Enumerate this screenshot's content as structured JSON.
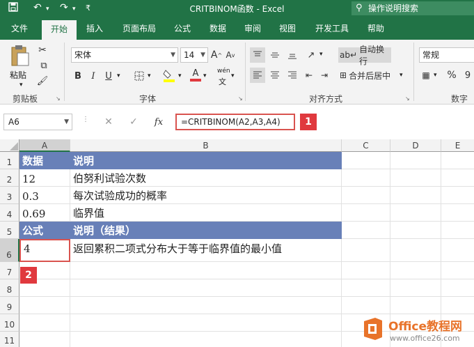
{
  "window": {
    "title": "CRITBINOM函数  -  Excel",
    "tell_me": "操作说明搜索"
  },
  "tabs": [
    "文件",
    "开始",
    "插入",
    "页面布局",
    "公式",
    "数据",
    "审阅",
    "视图",
    "开发工具",
    "帮助"
  ],
  "ribbon": {
    "clipboard": {
      "paste": "粘贴",
      "group": "剪贴板"
    },
    "font": {
      "name": "宋体",
      "size": "14",
      "group": "字体",
      "bold": "B",
      "italic": "I",
      "underline": "U",
      "grow": "A",
      "shrink": "A",
      "phonetic": "wén",
      "fontcolor": "A"
    },
    "alignment": {
      "wrap": "自动换行",
      "merge": "合并后居中",
      "group": "对齐方式"
    },
    "number": {
      "format": "常规",
      "percent": "%",
      "comma": "9",
      "group": "数字"
    }
  },
  "formula_bar": {
    "name_box": "A6",
    "cancel": "✕",
    "enter": "✓",
    "fx": "fx",
    "formula": "=CRITBINOM(A2,A3,A4)"
  },
  "callouts": [
    "1",
    "2"
  ],
  "columns": [
    "A",
    "B",
    "C",
    "D",
    "E"
  ],
  "rows": [
    "1",
    "2",
    "3",
    "4",
    "5",
    "6",
    "7",
    "8",
    "9",
    "10",
    "11"
  ],
  "cells": {
    "A1": "数据",
    "B1": "说明",
    "A2": "12",
    "B2": "伯努利试验次数",
    "A3": "0.3",
    "B3": "每次试验成功的概率",
    "A4": "0.69",
    "B4": "临界值",
    "A5": "公式",
    "B5": "说明（结果）",
    "A6": "4",
    "B6": "返回累积二项式分布大于等于临界值的最小值"
  },
  "watermark": {
    "brand": "Office教程网",
    "url": "www.office26.com"
  },
  "colors": {
    "excel_green": "#217346",
    "header_fill": "#6880b8",
    "callout_red": "#e0393e"
  }
}
